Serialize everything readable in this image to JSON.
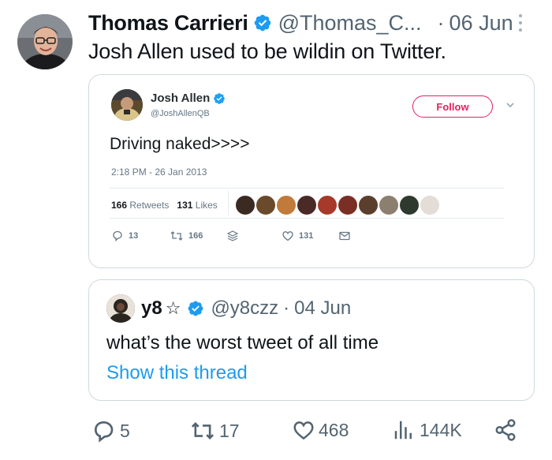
{
  "author": {
    "name": "Thomas Carrieri",
    "handle": "@Thomas_C...",
    "separator": "·",
    "date": "06 Jun"
  },
  "tweet": {
    "text": "Josh Allen used to be wildin on Twitter."
  },
  "embedded_tweet": {
    "name": "Josh Allen",
    "handle": "@JoshAllenQB",
    "follow_label": "Follow",
    "text": "Driving naked>>>>",
    "timestamp": "2:18 PM - 26 Jan 2013",
    "retweets_count": "166",
    "retweets_label": "Retweets",
    "likes_count": "131",
    "likes_label": "Likes",
    "reply_count": "13",
    "retweet_count": "166",
    "like_count": "131"
  },
  "quoted_tweet": {
    "name": "y8",
    "star": "☆",
    "handle": "@y8czz",
    "separator": "·",
    "date": "04 Jun",
    "text": "what’s the worst tweet of all time",
    "thread_link": "Show this thread"
  },
  "actions": {
    "replies": "5",
    "retweets": "17",
    "likes": "468",
    "views": "144K"
  },
  "colors": {
    "verified": "#1d9bf0",
    "link": "#1d9bf0",
    "follow": "#e0245e",
    "muted": "#536471"
  },
  "icons": [
    "verified-badge-icon",
    "more-icon",
    "reply-icon",
    "retweet-icon",
    "like-icon",
    "views-icon",
    "share-icon",
    "chevron-down-icon",
    "dm-icon",
    "stack-icon"
  ]
}
